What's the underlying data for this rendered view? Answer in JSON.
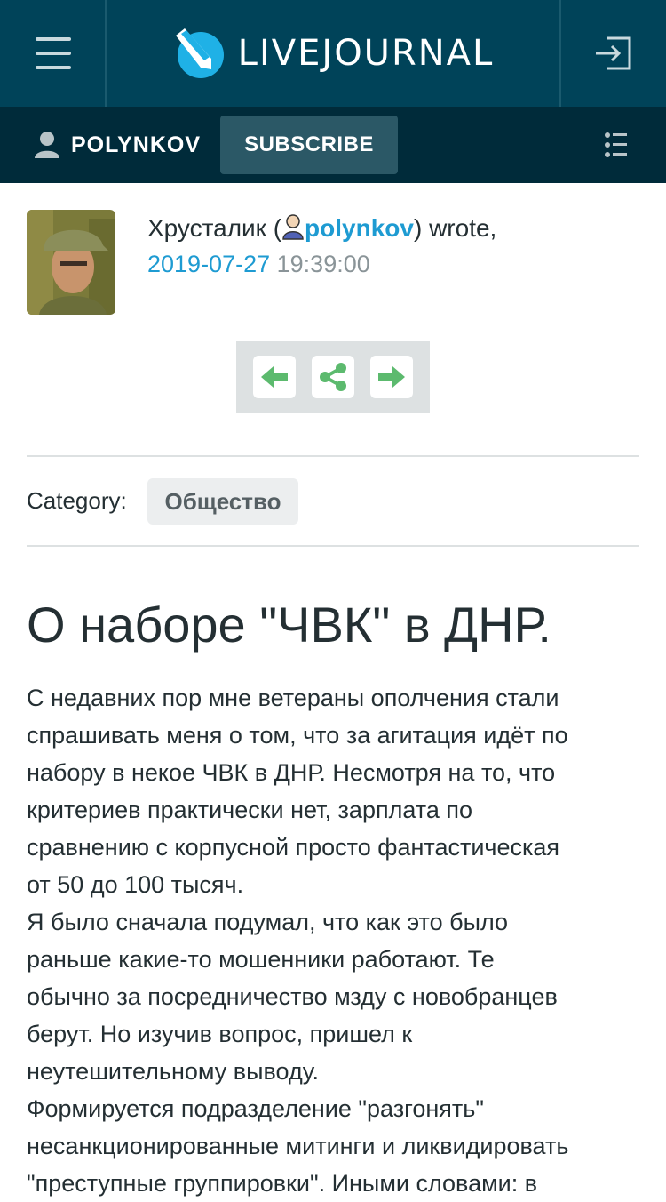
{
  "header": {
    "logo_text": "LIVEJOURNAL",
    "brand_color": "#004359"
  },
  "userbar": {
    "username": "POLYNKOV",
    "subscribe_label": "SUBSCRIBE"
  },
  "post": {
    "author_name": "Хрусталик",
    "author_open": " (",
    "author_link": "polynkov",
    "author_close": ") wrote,",
    "date": "2019-07-27",
    "time": "19:39:00",
    "category_label": "Category:",
    "category_tag": "Общество",
    "title": "О наборе \"ЧВК\" в ДНР.",
    "body_lines": [
      "С недавних пор мне ветераны ополчения стали",
      "спрашивать меня о том, что за агитация идёт по",
      "набору в некое ЧВК в ДНР. Несмотря на то, что",
      "критериев практически нет, зарплата по",
      "сравнению с корпусной просто фантастическая",
      "от 50 до 100 тысяч.",
      "Я было сначала подумал, что как это было",
      "раньше какие-то мошенники работают. Те",
      "обычно за посредничество мзду с новобранцев",
      "берут. Но изучив вопрос, пришел к",
      "неутешительному выводу.",
      "Формируется подразделение \"разгонять\"",
      "несанкционированные митинги и ликвидировать",
      "\"преступные группировки\". Иными словами: в"
    ]
  },
  "icons": {
    "menu": "hamburger-icon",
    "logo": "livejournal-logo-icon",
    "login": "login-icon",
    "user": "user-icon",
    "list": "list-icon",
    "prev": "arrow-left-icon",
    "share": "share-icon",
    "next": "arrow-right-icon",
    "author": "user-head-icon"
  },
  "colors": {
    "accent_link": "#1e9bd2",
    "nav_green": "#5cba6e",
    "userbar": "#002b3a"
  }
}
